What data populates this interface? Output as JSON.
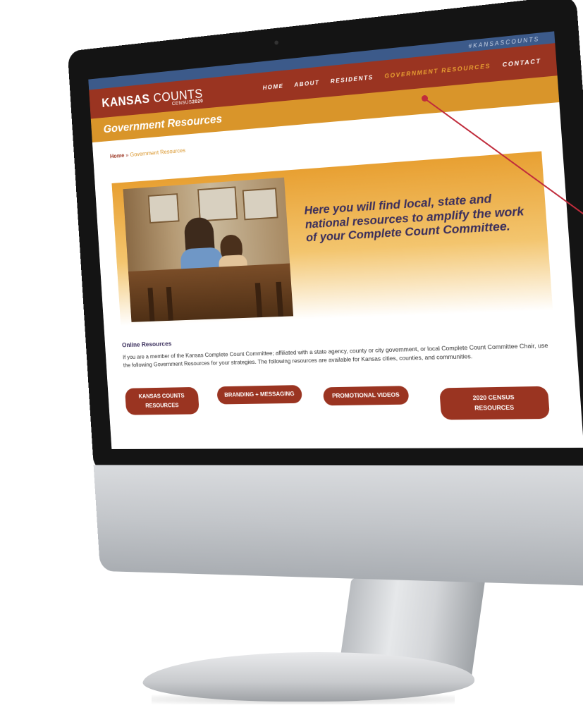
{
  "site": {
    "hashtag": "#KANSASCOUNTS",
    "logo": {
      "bold": "KANSAS",
      "light": "COUNTS",
      "sub_prefix": "CENSUS",
      "sub_year": "2020"
    },
    "nav": [
      {
        "label": "HOME",
        "active": false
      },
      {
        "label": "ABOUT",
        "active": false
      },
      {
        "label": "RESIDENTS",
        "active": false
      },
      {
        "label": "GOVERNMENT RESOURCES",
        "active": true
      },
      {
        "label": "CONTACT",
        "active": false
      }
    ],
    "page_title": "Government Resources",
    "breadcrumb": {
      "home": "Home",
      "separator": " » ",
      "current": "Government Resources"
    },
    "hero_text": "Here you will find local, state and national resources to amplify the work of your Complete Count Committee.",
    "section": {
      "heading": "Online Resources",
      "body": "If you are a member of the Kansas Complete Count Committee; affiliated with a state agency, county or city government, or local Complete Count Committee Chair, use the following Government Resources for your strategies. The following resources are available for Kansas cities, counties, and communities."
    },
    "buttons": [
      {
        "line1": "KANSAS COUNTS",
        "line2": "RESOURCES"
      },
      {
        "line1": "BRANDING + MESSAGING",
        "line2": ""
      },
      {
        "line1": "PROMOTIONAL VIDEOS",
        "line2": ""
      },
      {
        "line1": "2020 CENSUS",
        "line2": "RESOURCES"
      }
    ]
  },
  "colors": {
    "brand_red": "#9a3421",
    "brand_gold": "#d9952a",
    "brand_blue": "#3c5a8a",
    "text_purple": "#3a2e5c",
    "callout": "#c02c3c"
  }
}
